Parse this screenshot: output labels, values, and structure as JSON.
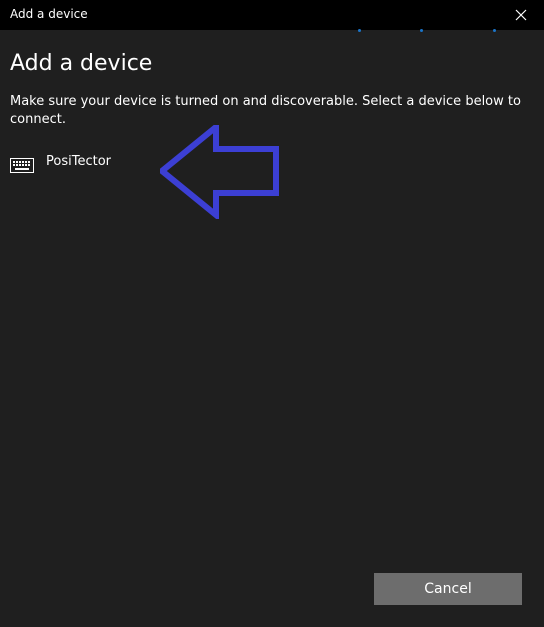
{
  "window": {
    "title": "Add a device"
  },
  "page": {
    "title": "Add a device",
    "instructions": "Make sure your device is turned on and discoverable. Select a device below to connect."
  },
  "devices": [
    {
      "name": "PosiTector",
      "icon": "keyboard-icon"
    }
  ],
  "footer": {
    "cancel_label": "Cancel"
  },
  "icons": {
    "close": "close-icon",
    "device": "keyboard-icon",
    "annotation": "left-arrow-outline"
  },
  "colors": {
    "background": "#1f1f1f",
    "titlebar": "#000000",
    "text": "#ffffff",
    "button": "#6d6d6d",
    "progress_dots": "#1b74c7",
    "annotation_arrow": "#3c3fd4"
  }
}
